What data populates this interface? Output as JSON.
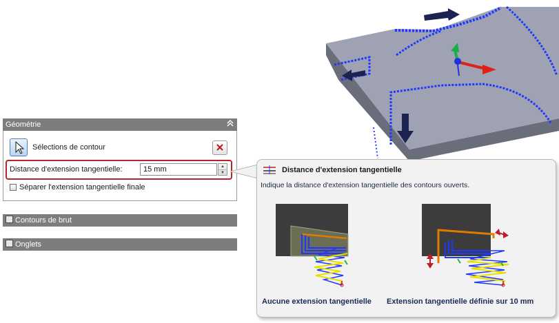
{
  "panel": {
    "geometry": {
      "header": "Géométrie",
      "collapse_icon": "double-chevron-up",
      "contour_selection_label": "Sélections de contour",
      "tangent_extension_label": "Distance d'extension tangentielle:",
      "tangent_extension_value": "15 mm",
      "separate_final_extension_label": "Séparer l'extension tangentielle finale",
      "separate_final_extension_checked": false
    },
    "stock_contours_header": "Contours de brut",
    "tabs_header": "Onglets"
  },
  "tooltip": {
    "title": "Distance d'extension tangentielle",
    "description": "Indique la distance d'extension tangentielle des contours ouverts.",
    "caption_left": "Aucune extension tangentielle",
    "caption_right": "Extension tangentielle définie sur 10 mm"
  },
  "colors": {
    "header_bg": "#7d7d7d",
    "highlight_border": "#b8242a",
    "part_face": "#9b9fb0",
    "toolpath_blue": "#1e38ff",
    "arrow_navy": "#1d2350"
  }
}
